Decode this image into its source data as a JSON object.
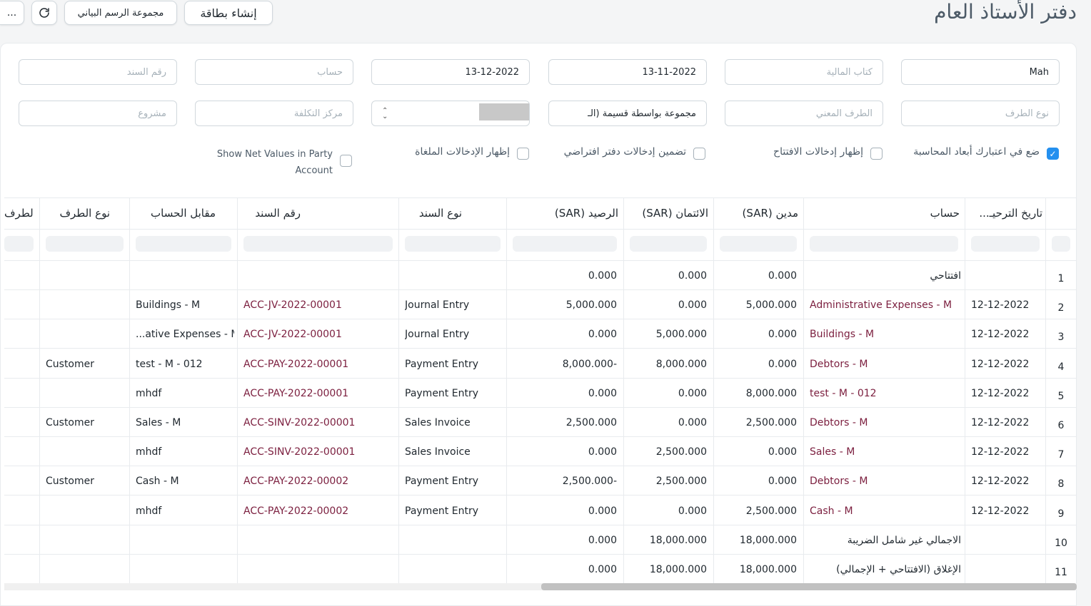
{
  "header": {
    "title": "دفتر الأستاذ العام",
    "create_card": "إنشاء بطاقة",
    "chart_group": "مجموعة الرسم البياني",
    "more": "...",
    "refresh_icon": "refresh-icon"
  },
  "filters": {
    "company": "Mah",
    "finance_book": "كتاب المالية",
    "from_date": "13-11-2022",
    "to_date": "13-12-2022",
    "account": "حساب",
    "voucher_no": "رقم السند",
    "party_type": "نوع الطرف",
    "party": "الطرف المعني",
    "group_by": "مجموعة بواسطة قسيمة (الـ",
    "cost_center": "مركز التكلفة",
    "project": "مشروع"
  },
  "checks": {
    "accounting_dims": "ضع في اعتبارك أبعاد المحاسبة",
    "show_opening": "إظهار إدخالات الافتتاح",
    "include_default": "تضمين إدخالات دفتر افتراضي",
    "show_cancelled": "إظهار الإدخالات الملغاة",
    "net_values_1": "Show Net Values in Party",
    "net_values_2": "Account"
  },
  "table": {
    "headers": {
      "posting_date": "تاريخ الترحيـ...",
      "account": "حساب",
      "debit": "مدين (SAR)",
      "credit": "الائتمان (SAR)",
      "balance": "الرصيد (SAR)",
      "voucher_type": "نوع السند",
      "voucher_no": "رقم السند",
      "against": "مقابل الحساب",
      "party_type": "نوع الطرف",
      "party": "الطرف"
    },
    "rows": [
      {
        "n": "1",
        "date": "",
        "account": "افتتاحي",
        "debit": "0.000",
        "credit": "0.000",
        "balance": "0.000",
        "vtype": "",
        "vno": "",
        "against": "",
        "ptype": ""
      },
      {
        "n": "2",
        "date": "12-12-2022",
        "account": "Administrative Expenses - M",
        "debit": "5,000.000",
        "credit": "0.000",
        "balance": "5,000.000",
        "vtype": "Journal Entry",
        "vno": "ACC-JV-2022-00001",
        "against": "Buildings - M",
        "ptype": ""
      },
      {
        "n": "3",
        "date": "12-12-2022",
        "account": "Buildings - M",
        "debit": "0.000",
        "credit": "5,000.000",
        "balance": "0.000",
        "vtype": "Journal Entry",
        "vno": "ACC-JV-2022-00001",
        "against": "...ative Expenses - M",
        "ptype": ""
      },
      {
        "n": "4",
        "date": "12-12-2022",
        "account": "Debtors - M",
        "debit": "0.000",
        "credit": "8,000.000",
        "balance": "8,000.000-",
        "vtype": "Payment Entry",
        "vno": "ACC-PAY-2022-00001",
        "against": "test - M - 012",
        "ptype": "Customer"
      },
      {
        "n": "5",
        "date": "12-12-2022",
        "account": "test - M - 012",
        "debit": "8,000.000",
        "credit": "0.000",
        "balance": "0.000",
        "vtype": "Payment Entry",
        "vno": "ACC-PAY-2022-00001",
        "against": "mhdf",
        "ptype": ""
      },
      {
        "n": "6",
        "date": "12-12-2022",
        "account": "Debtors - M",
        "debit": "2,500.000",
        "credit": "0.000",
        "balance": "2,500.000",
        "vtype": "Sales Invoice",
        "vno": "ACC-SINV-2022-00001",
        "against": "Sales - M",
        "ptype": "Customer"
      },
      {
        "n": "7",
        "date": "12-12-2022",
        "account": "Sales - M",
        "debit": "0.000",
        "credit": "2,500.000",
        "balance": "0.000",
        "vtype": "Sales Invoice",
        "vno": "ACC-SINV-2022-00001",
        "against": "mhdf",
        "ptype": ""
      },
      {
        "n": "8",
        "date": "12-12-2022",
        "account": "Debtors - M",
        "debit": "0.000",
        "credit": "2,500.000",
        "balance": "2,500.000-",
        "vtype": "Payment Entry",
        "vno": "ACC-PAY-2022-00002",
        "against": "Cash - M",
        "ptype": "Customer"
      },
      {
        "n": "9",
        "date": "12-12-2022",
        "account": "Cash - M",
        "debit": "2,500.000",
        "credit": "0.000",
        "balance": "0.000",
        "vtype": "Payment Entry",
        "vno": "ACC-PAY-2022-00002",
        "against": "mhdf",
        "ptype": ""
      },
      {
        "n": "10",
        "date": "",
        "account": "الاجمالي غير شامل الضريبة",
        "debit": "18,000.000",
        "credit": "18,000.000",
        "balance": "0.000",
        "vtype": "",
        "vno": "",
        "against": "",
        "ptype": ""
      },
      {
        "n": "11",
        "date": "",
        "account": "الإغلاق (الافتتاحي + الإجمالي)",
        "debit": "18,000.000",
        "credit": "18,000.000",
        "balance": "0.000",
        "vtype": "",
        "vno": "",
        "against": "",
        "ptype": ""
      }
    ]
  },
  "colors": {
    "link": "#7b1e3e",
    "check": "#2490ef"
  }
}
